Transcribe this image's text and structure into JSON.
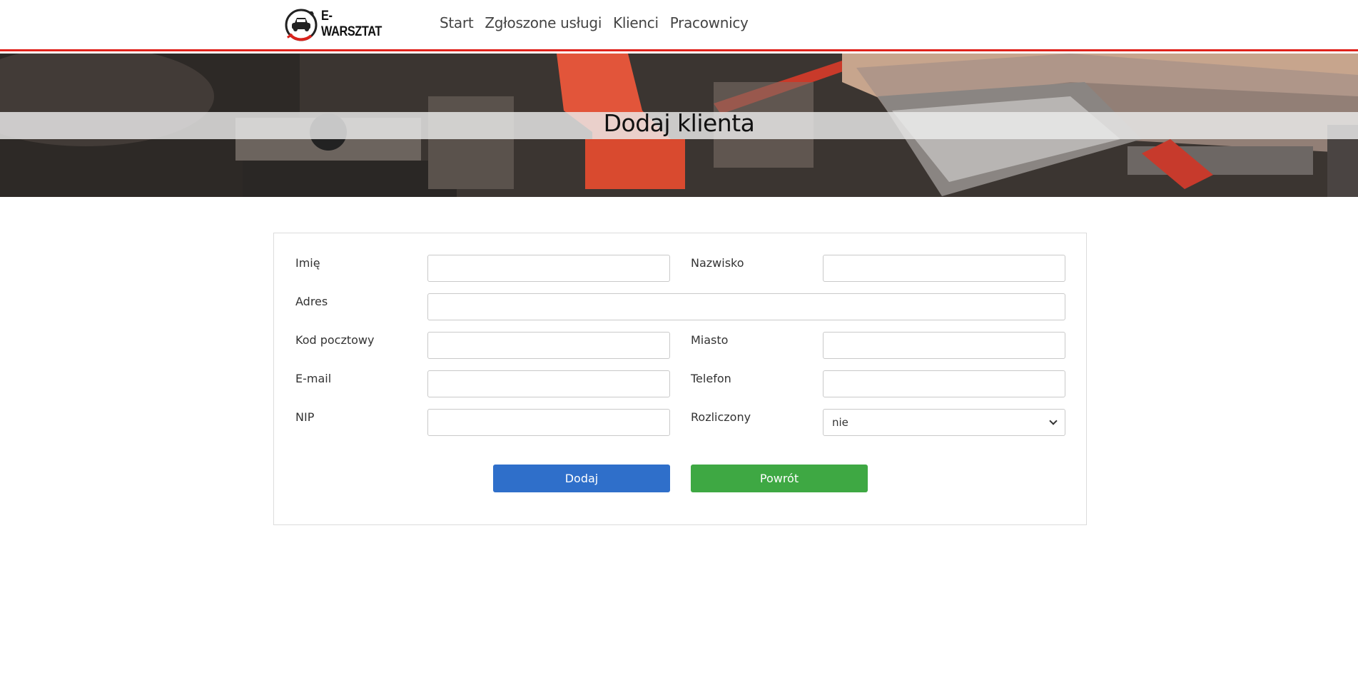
{
  "header": {
    "logo_text": "E-WARSZTAT",
    "nav": [
      {
        "label": "Start"
      },
      {
        "label": "Zgłoszone usługi"
      },
      {
        "label": "Klienci"
      },
      {
        "label": "Pracownicy"
      }
    ],
    "accent_color": "#e0231c"
  },
  "hero": {
    "title": "Dodaj klienta"
  },
  "form": {
    "fields": {
      "first_name": {
        "label": "Imię",
        "value": ""
      },
      "last_name": {
        "label": "Nazwisko",
        "value": ""
      },
      "address": {
        "label": "Adres",
        "value": ""
      },
      "postal_code": {
        "label": "Kod pocztowy",
        "value": ""
      },
      "city": {
        "label": "Miasto",
        "value": ""
      },
      "email": {
        "label": "E-mail",
        "value": ""
      },
      "phone": {
        "label": "Telefon",
        "value": ""
      },
      "nip": {
        "label": "NIP",
        "value": ""
      },
      "settled": {
        "label": "Rozliczony",
        "value": "nie"
      }
    },
    "buttons": {
      "add": {
        "label": "Dodaj",
        "color": "#2f6fca"
      },
      "back": {
        "label": "Powrót",
        "color": "#3ea843"
      }
    }
  }
}
